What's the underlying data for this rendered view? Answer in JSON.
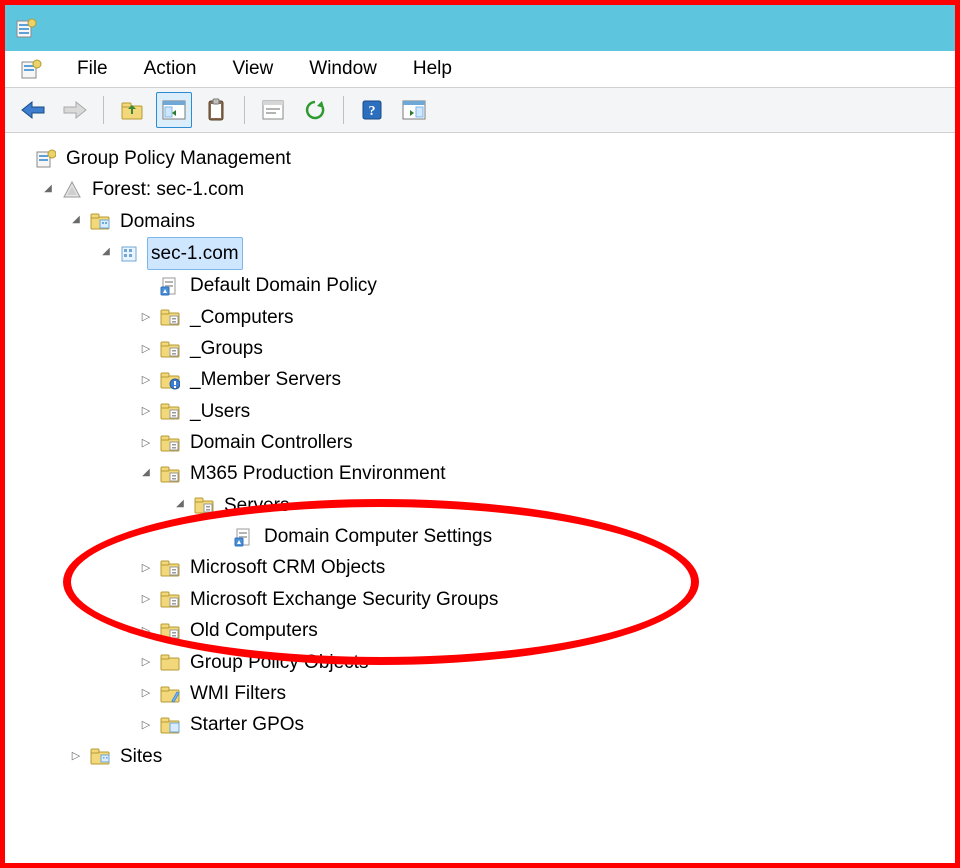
{
  "menu": {
    "file": "File",
    "action": "Action",
    "view": "View",
    "window": "Window",
    "help": "Help"
  },
  "tree": {
    "root": "Group Policy Management",
    "forest": "Forest: sec-1.com",
    "domains": "Domains",
    "domain": "sec-1.com",
    "ddp": "Default Domain Policy",
    "computers": "_Computers",
    "groups": "_Groups",
    "member_servers": "_Member Servers",
    "users": "_Users",
    "dc": "Domain Controllers",
    "m365": "M365 Production Environment",
    "servers": "Servers",
    "dcs": "Domain Computer Settings",
    "crm": "Microsoft CRM Objects",
    "exch": "Microsoft Exchange Security Groups",
    "oldc": "Old Computers",
    "gpo": "Group Policy Objects",
    "wmi": "WMI Filters",
    "starter": "Starter GPOs",
    "sites": "Sites"
  }
}
